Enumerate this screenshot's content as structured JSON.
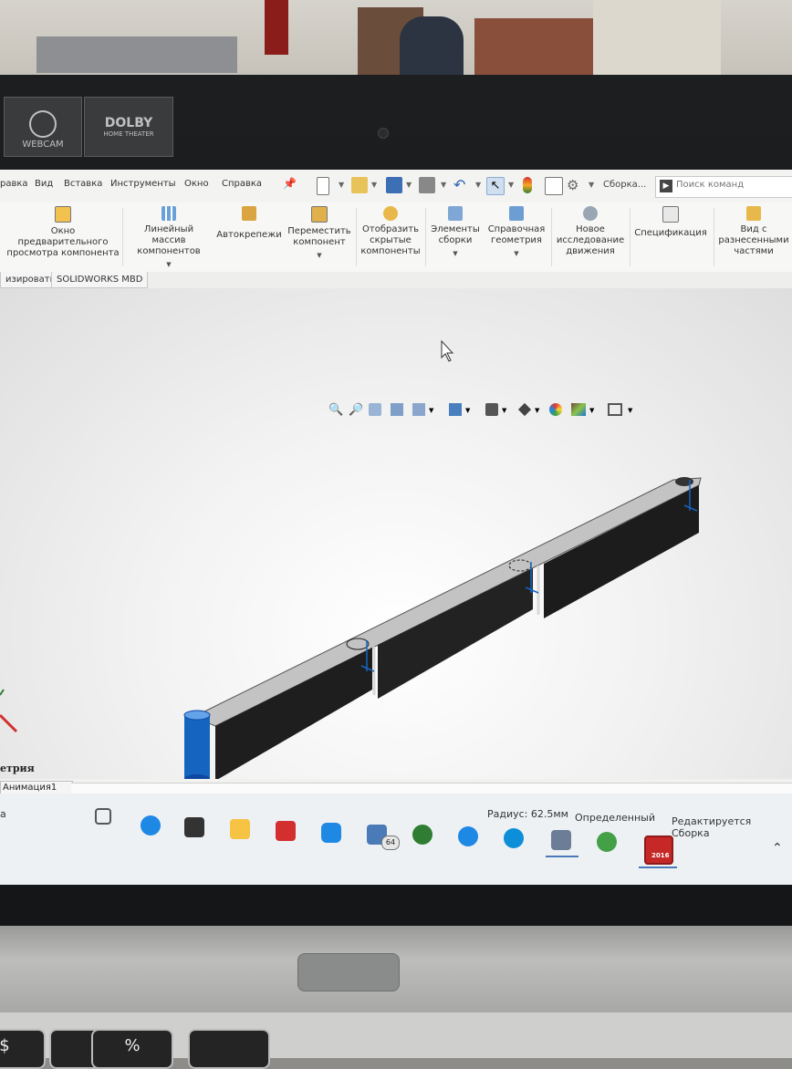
{
  "sticker": {
    "webcam": "WEBCAM",
    "dolby_brand": "DOLBY",
    "dolby_sub": "HOME THEATER"
  },
  "menu": {
    "items": [
      "равка",
      "Вид",
      "Вставка",
      "Инструменты",
      "Окно",
      "Справка"
    ],
    "assembly_label": "Сборка...",
    "search_placeholder": "Поиск команд"
  },
  "ribbon": {
    "preview_window": "Окно предварительного просмотра компонента",
    "linear_pattern": "Линейный массив компонентов",
    "smart_fasteners": "Автокрепежи",
    "move_component": "Переместить компонент",
    "show_hidden": "Отобразить скрытые компоненты",
    "assembly_features": "Элементы сборки",
    "reference_geometry": "Справочная геометрия",
    "new_motion_study": "Новое исследование движения",
    "bom": "Спецификация",
    "exploded_view": "Вид с разнесенными частями"
  },
  "tabs": [
    "изировать",
    "SOLIDWORKS MBD"
  ],
  "bottom": {
    "panel_label": "етрия",
    "animation_tab": "Анимация1"
  },
  "status": {
    "left_char": "а",
    "radius": "Радиус: 62.5мм",
    "state": "Определенный",
    "editing": "Редактируется Сборка",
    "badge_count": "64",
    "sw_year": "2016"
  },
  "keyboard": {
    "key1": "$",
    "key2": "%"
  },
  "colors": {
    "accent_blue": "#1565c0",
    "part_dark": "#1f1f1f",
    "part_top": "#bfbfbf",
    "sw_red": "#c62828"
  }
}
